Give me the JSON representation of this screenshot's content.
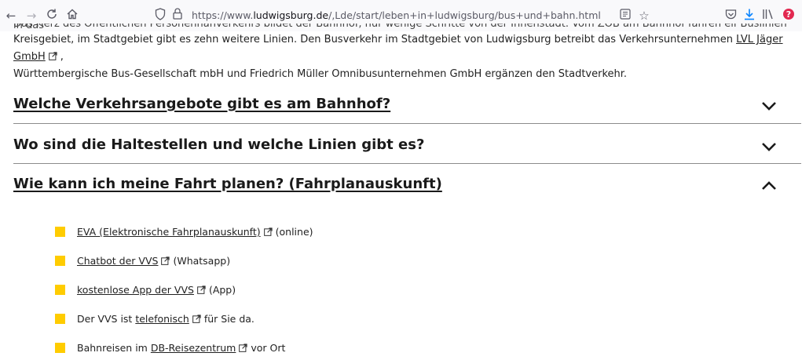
{
  "browser": {
    "url_prefix": "https://www.",
    "url_domain": "ludwigsburg.de",
    "url_path": "/,Lde/start/leben+in+ludwigsburg/bus+und+bahn.html"
  },
  "intro": {
    "cut_line": "Das Herz des Öffentlichen Personennahverkehrs bildet der Bahnhof, nur wenige Schritte von der Innenstadt. Vom ZOB am Bahnhof fahren elf Buslinien in das",
    "line2_pre": "Kreisgebiet, im Stadtgebiet gibt es zehn weitere Linien. Den Busverkehr im Stadtgebiet von Ludwigsburg betreibt das Verkehrsunternehmen ",
    "line2_link": "LVL Jäger GmbH",
    "line2_post": ",",
    "line3": "Württembergische Bus-Gesellschaft mbH und Friedrich Müller Omnibusunternehmen GmbH ergänzen den Stadtverkehr."
  },
  "accordion": [
    {
      "title": "Welche Verkehrsangebote gibt es am Bahnhof?",
      "expanded": false
    },
    {
      "title": "Wo sind die Haltestellen und welche Linien gibt es?",
      "expanded": false
    },
    {
      "title": "Wie kann ich meine Fahrt planen? (Fahrplanauskunft)",
      "expanded": true
    }
  ],
  "list": [
    {
      "pre": "",
      "link": "EVA (Elektronische Fahrplanauskunft)",
      "post": "(online)"
    },
    {
      "pre": "",
      "link": "Chatbot der VVS",
      "post": "(Whatsapp)"
    },
    {
      "pre": "",
      "link": "kostenlose App der VVS",
      "post": "(App)"
    },
    {
      "pre": "Der VVS ist ",
      "link": "telefonisch",
      "post": "für Sie da."
    },
    {
      "pre": "Bahnreisen im ",
      "link": "DB-Reisezentrum",
      "post": "vor Ort"
    }
  ],
  "colors": {
    "bullet": "#ffcc00",
    "divider": "#8c8c8c"
  }
}
